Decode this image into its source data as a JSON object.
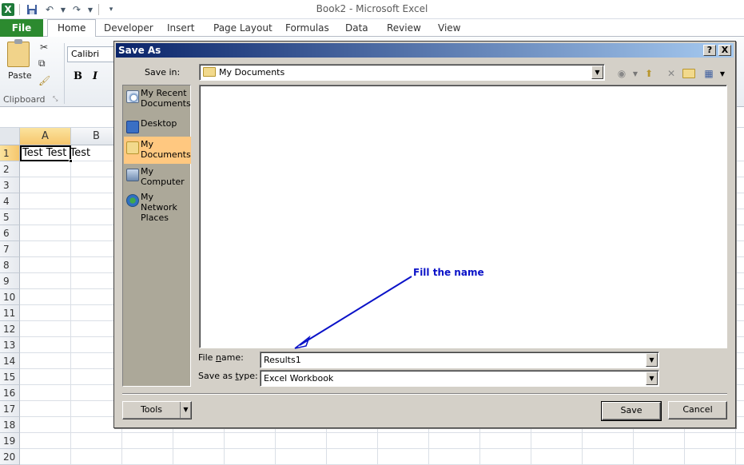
{
  "window": {
    "title": "Book2  -  Microsoft Excel"
  },
  "ribbon": {
    "tabs": {
      "file": "File",
      "home": "Home",
      "developer": "Developer",
      "insert": "Insert",
      "page_layout": "Page Layout",
      "formulas": "Formulas",
      "data": "Data",
      "review": "Review",
      "view": "View"
    },
    "paste_label": "Paste",
    "font_name": "Calibri",
    "bold": "B",
    "italic": "I",
    "clipboard_label": "Clipboard"
  },
  "sheet": {
    "columns": [
      "A",
      "B"
    ],
    "rows": [
      "1",
      "2",
      "3",
      "4",
      "5",
      "6",
      "7",
      "8",
      "9",
      "10",
      "11",
      "12",
      "13",
      "14",
      "15",
      "16",
      "17",
      "18",
      "19",
      "20"
    ],
    "cell_a1": "Test Test Test"
  },
  "dialog": {
    "title": "Save As",
    "save_in_label": "Save in:",
    "save_in_value": "My Documents",
    "places": {
      "recent": "My Recent Documents",
      "desktop": "Desktop",
      "documents": "My Documents",
      "computer": "My Computer",
      "network": "My Network Places"
    },
    "file_name_label": "File name:",
    "file_name_value": "Results1",
    "save_type_label": "Save as type:",
    "save_type_value": "Excel Workbook",
    "tools_label": "Tools",
    "save_label": "Save",
    "cancel_label": "Cancel",
    "help_button": "?",
    "close_button": "X"
  },
  "annotation": {
    "text": "Fill the name",
    "color": "#0a12c8"
  }
}
